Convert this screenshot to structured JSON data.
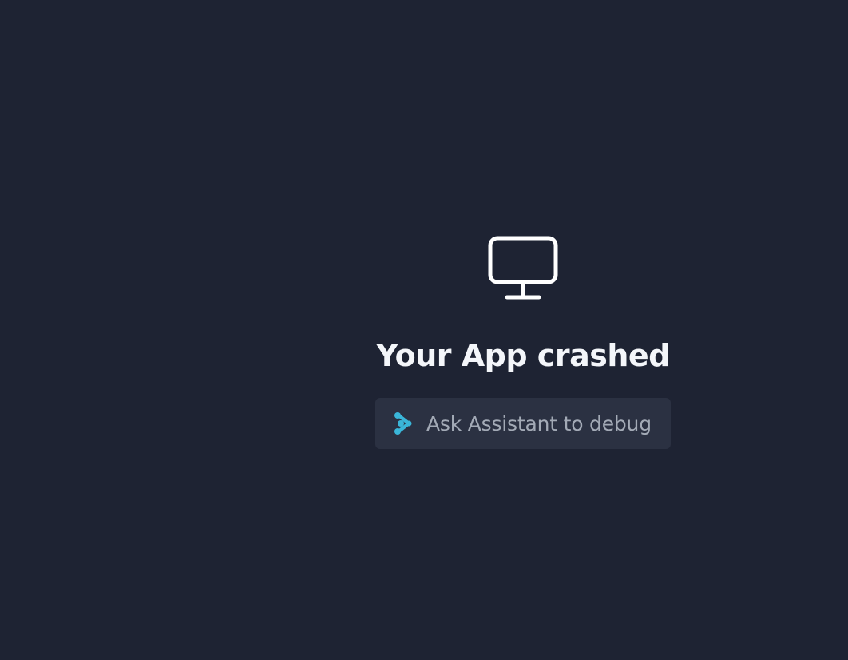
{
  "crash": {
    "title": "Your App crashed",
    "icon": "monitor-icon"
  },
  "debug_button": {
    "label": "Ask Assistant to debug",
    "icon": "assistant-icon"
  },
  "colors": {
    "background": "#1e2333",
    "button_background": "#2b3142",
    "title_text": "#f4f6fa",
    "button_text": "#a3aab6",
    "assistant_accent": "#3ab6d9"
  }
}
